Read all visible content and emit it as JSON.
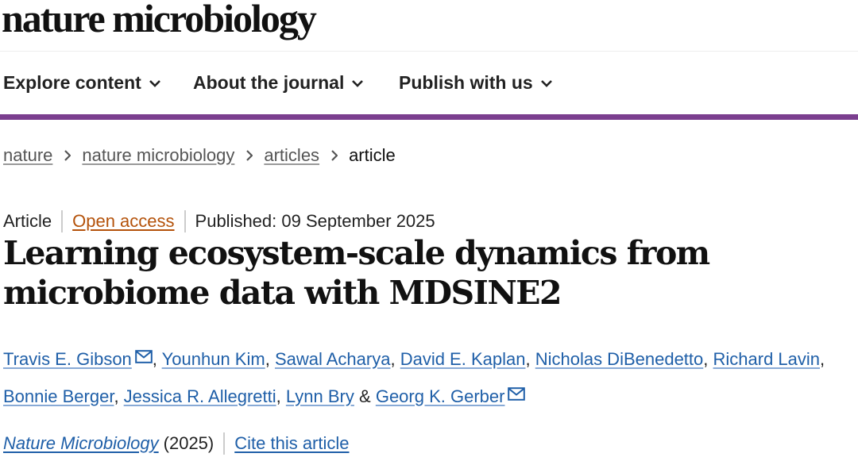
{
  "header": {
    "logo_text": "nature microbiology"
  },
  "nav": {
    "items": [
      {
        "label": "Explore content"
      },
      {
        "label": "About the journal"
      },
      {
        "label": "Publish with us"
      }
    ],
    "accent_color": "#7b3f8f"
  },
  "breadcrumb": {
    "items": [
      "nature",
      "nature microbiology",
      "articles"
    ],
    "current": "article"
  },
  "article": {
    "type": "Article",
    "access": "Open access",
    "published": "Published: 09 September 2025",
    "title": "Learning ecosystem-scale dynamics from microbiome data with MDSINE2",
    "authors": [
      "Travis E. Gibson",
      "Younhun Kim",
      "Sawal Acharya",
      "David E. Kaplan",
      "Nicholas DiBenedetto",
      "Richard Lavin",
      "Bonnie Berger",
      "Jessica R. Allegretti",
      "Lynn Bry",
      "Georg K. Gerber"
    ],
    "authors_conjunction": "&",
    "journal": "Nature Microbiology",
    "year": "(2025)",
    "cite_label": "Cite this article"
  },
  "colors": {
    "link": "#1f5fa8",
    "open_access": "#b4520a"
  }
}
